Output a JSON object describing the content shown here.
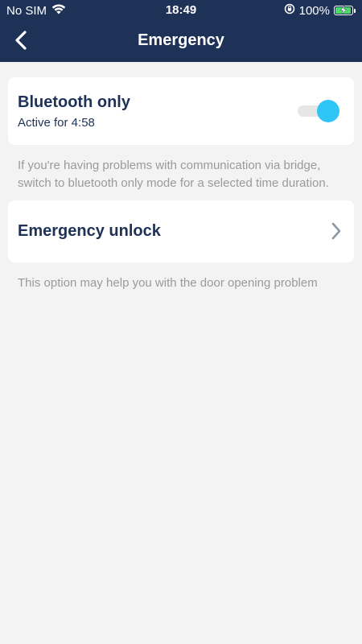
{
  "status_bar": {
    "carrier": "No SIM",
    "time": "18:49",
    "battery_percent": "100%",
    "battery_level": 1.0
  },
  "nav": {
    "title": "Emergency",
    "back_icon": "chevron-left-icon"
  },
  "bluetooth_card": {
    "title": "Bluetooth only",
    "subtitle": "Active for 4:58",
    "toggle_on": true,
    "toggle_color": "#30c5f7"
  },
  "bluetooth_hint": "If you're having problems with communication via bridge, switch to bluetooth only mode for a selected time duration.",
  "unlock_card": {
    "title": "Emergency unlock",
    "chevron_icon": "chevron-right-icon"
  },
  "unlock_hint": "This option may help you with the door opening problem",
  "colors": {
    "header_bg": "#1e3157",
    "page_bg": "#f3f3f3",
    "accent": "#30c5f7",
    "title_text": "#1e3157",
    "hint_text": "#9a9a9a"
  }
}
